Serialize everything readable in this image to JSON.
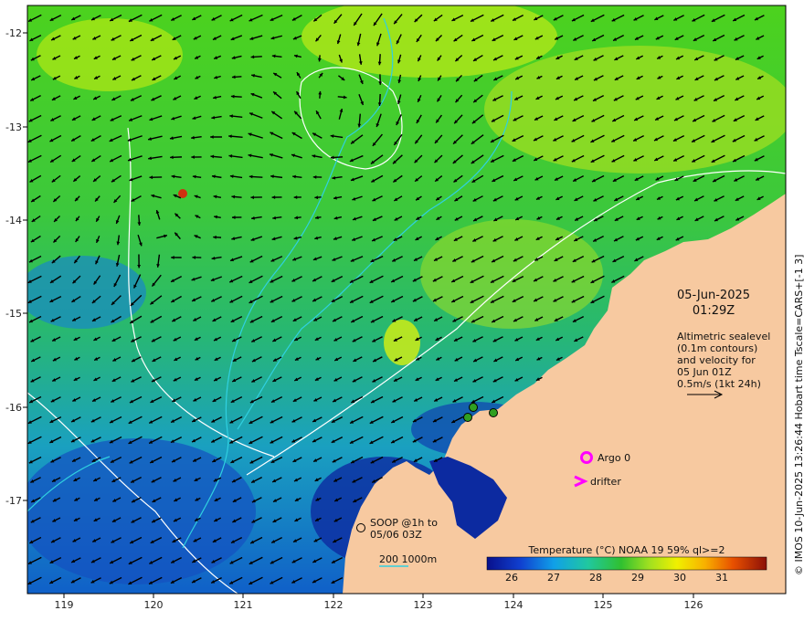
{
  "axes": {
    "x_ticks": [
      "119",
      "120",
      "121",
      "122",
      "123",
      "124",
      "125",
      "126"
    ],
    "y_ticks": [
      "-12",
      "-13",
      "-14",
      "-15",
      "-16",
      "-17"
    ]
  },
  "datetime": {
    "date": "05-Jun-2025",
    "time": "01:29Z"
  },
  "legend_text": {
    "line1": "Altimetric sealevel",
    "line2": "(0.1m contours)",
    "line3": "and velocity for",
    "line4": "05 Jun 01Z",
    "line5": "0.5m/s (1kt 24h)"
  },
  "markers": {
    "argo_label": "Argo 0",
    "drifter_label": "drifter",
    "soop_line1": "SOOP @1h to",
    "soop_line2": "05/06 03Z",
    "depth_label": "200  1000m"
  },
  "colorbar": {
    "title": "Temperature (°C) NOAA 19 59% ql>=2",
    "ticks": [
      "26",
      "27",
      "28",
      "29",
      "30",
      "31"
    ]
  },
  "credit": "© IMOS 10-Jun-2025 13:26:44 Hobart time Tscale=CARS+[-1 3]",
  "colors": {
    "land": "#f7c9a0",
    "argo": "#ff00ff",
    "drifter": "#ff00ff",
    "contour_white": "#ffffff",
    "contour_cyan": "#30d0e0"
  }
}
